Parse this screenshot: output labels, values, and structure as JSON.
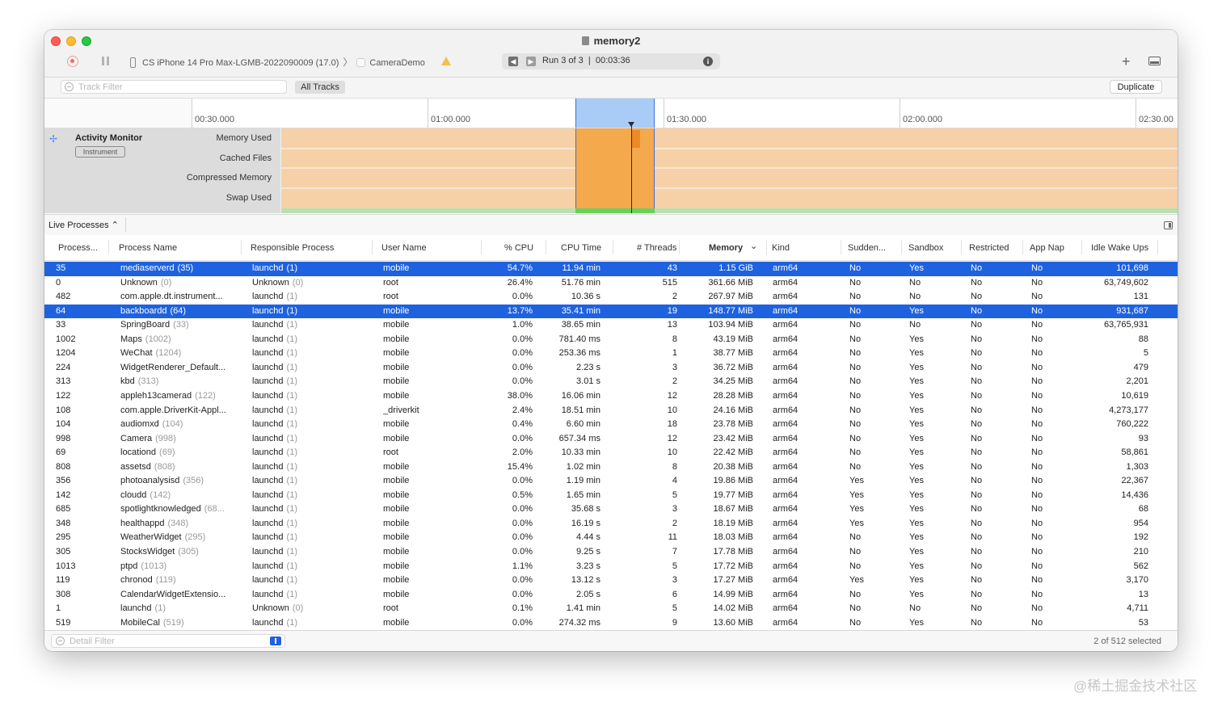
{
  "window": {
    "title": "memory2",
    "device": "CS iPhone 14 Pro Max-LGMB-2022090009 (17.0)",
    "path_separator": "〉",
    "target_app": "CameraDemo",
    "run_label": "Run 3 of 3",
    "run_separator": "|",
    "run_time": "00:03:36",
    "info_glyph": "i",
    "add_glyph": "+",
    "prev_glyph": "◀",
    "next_glyph": "▶"
  },
  "filterbar": {
    "track_filter_placeholder": "Track Filter",
    "all_tracks_label": "All Tracks",
    "duplicate_label": "Duplicate"
  },
  "timeline": {
    "ticks": [
      "00:30.000",
      "01:00.000",
      "01:30.000",
      "02:00.000",
      "02:30.00"
    ]
  },
  "instrument": {
    "icon_glyph": "✢",
    "name": "Activity Monitor",
    "badge": "Instrument",
    "lanes": [
      "Memory Used",
      "Cached Files",
      "Compressed Memory",
      "Swap Used"
    ]
  },
  "live_processes": {
    "label": "Live Processes ⌃"
  },
  "table": {
    "columns": [
      "Process...",
      "Process Name",
      "Responsible Process",
      "User Name",
      "% CPU",
      "CPU Time",
      "# Threads",
      "Memory",
      "Kind",
      "Sudden...",
      "Sandbox",
      "Restricted",
      "App Nap",
      "Idle Wake Ups"
    ],
    "sort_indicator": "⌄",
    "rows": [
      {
        "pid": "35",
        "name": "mediaserverd",
        "npid": "(35)",
        "resp": "launchd",
        "rpid": "(1)",
        "user": "mobile",
        "cpu": "54.7%",
        "time": "11.94 min",
        "threads": "43",
        "mem": "1.15 GiB",
        "kind": "arm64",
        "sudden": "No",
        "sandbox": "Yes",
        "restricted": "No",
        "nap": "No",
        "wake": "101,698",
        "selected": true
      },
      {
        "pid": "0",
        "name": "Unknown",
        "npid": "(0)",
        "resp": "Unknown",
        "rpid": "(0)",
        "user": "root",
        "cpu": "26.4%",
        "time": "51.76 min",
        "threads": "515",
        "mem": "361.66 MiB",
        "kind": "arm64",
        "sudden": "No",
        "sandbox": "No",
        "restricted": "No",
        "nap": "No",
        "wake": "63,749,602",
        "selected": false
      },
      {
        "pid": "482",
        "name": "com.apple.dt.instrument...",
        "npid": "",
        "resp": "launchd",
        "rpid": "(1)",
        "user": "root",
        "cpu": "0.0%",
        "time": "10.36 s",
        "threads": "2",
        "mem": "267.97 MiB",
        "kind": "arm64",
        "sudden": "No",
        "sandbox": "No",
        "restricted": "No",
        "nap": "No",
        "wake": "131",
        "selected": false
      },
      {
        "pid": "64",
        "name": "backboardd",
        "npid": "(64)",
        "resp": "launchd",
        "rpid": "(1)",
        "user": "mobile",
        "cpu": "13.7%",
        "time": "35.41 min",
        "threads": "19",
        "mem": "148.77 MiB",
        "kind": "arm64",
        "sudden": "No",
        "sandbox": "Yes",
        "restricted": "No",
        "nap": "No",
        "wake": "931,687",
        "selected": true
      },
      {
        "pid": "33",
        "name": "SpringBoard",
        "npid": "(33)",
        "resp": "launchd",
        "rpid": "(1)",
        "user": "mobile",
        "cpu": "1.0%",
        "time": "38.65 min",
        "threads": "13",
        "mem": "103.94 MiB",
        "kind": "arm64",
        "sudden": "No",
        "sandbox": "No",
        "restricted": "No",
        "nap": "No",
        "wake": "63,765,931",
        "selected": false
      },
      {
        "pid": "1002",
        "name": "Maps",
        "npid": "(1002)",
        "resp": "launchd",
        "rpid": "(1)",
        "user": "mobile",
        "cpu": "0.0%",
        "time": "781.40 ms",
        "threads": "8",
        "mem": "43.19 MiB",
        "kind": "arm64",
        "sudden": "No",
        "sandbox": "Yes",
        "restricted": "No",
        "nap": "No",
        "wake": "88",
        "selected": false
      },
      {
        "pid": "1204",
        "name": "WeChat",
        "npid": "(1204)",
        "resp": "launchd",
        "rpid": "(1)",
        "user": "mobile",
        "cpu": "0.0%",
        "time": "253.36 ms",
        "threads": "1",
        "mem": "38.77 MiB",
        "kind": "arm64",
        "sudden": "No",
        "sandbox": "Yes",
        "restricted": "No",
        "nap": "No",
        "wake": "5",
        "selected": false
      },
      {
        "pid": "224",
        "name": "WidgetRenderer_Default...",
        "npid": "",
        "resp": "launchd",
        "rpid": "(1)",
        "user": "mobile",
        "cpu": "0.0%",
        "time": "2.23 s",
        "threads": "3",
        "mem": "36.72 MiB",
        "kind": "arm64",
        "sudden": "No",
        "sandbox": "Yes",
        "restricted": "No",
        "nap": "No",
        "wake": "479",
        "selected": false
      },
      {
        "pid": "313",
        "name": "kbd",
        "npid": "(313)",
        "resp": "launchd",
        "rpid": "(1)",
        "user": "mobile",
        "cpu": "0.0%",
        "time": "3.01 s",
        "threads": "2",
        "mem": "34.25 MiB",
        "kind": "arm64",
        "sudden": "No",
        "sandbox": "Yes",
        "restricted": "No",
        "nap": "No",
        "wake": "2,201",
        "selected": false
      },
      {
        "pid": "122",
        "name": "appleh13camerad",
        "npid": "(122)",
        "resp": "launchd",
        "rpid": "(1)",
        "user": "mobile",
        "cpu": "38.0%",
        "time": "16.06 min",
        "threads": "12",
        "mem": "28.28 MiB",
        "kind": "arm64",
        "sudden": "No",
        "sandbox": "Yes",
        "restricted": "No",
        "nap": "No",
        "wake": "10,619",
        "selected": false
      },
      {
        "pid": "108",
        "name": "com.apple.DriverKit-Appl...",
        "npid": "",
        "resp": "launchd",
        "rpid": "(1)",
        "user": "_driverkit",
        "cpu": "2.4%",
        "time": "18.51 min",
        "threads": "10",
        "mem": "24.16 MiB",
        "kind": "arm64",
        "sudden": "No",
        "sandbox": "Yes",
        "restricted": "No",
        "nap": "No",
        "wake": "4,273,177",
        "selected": false
      },
      {
        "pid": "104",
        "name": "audiomxd",
        "npid": "(104)",
        "resp": "launchd",
        "rpid": "(1)",
        "user": "mobile",
        "cpu": "0.4%",
        "time": "6.60 min",
        "threads": "18",
        "mem": "23.78 MiB",
        "kind": "arm64",
        "sudden": "No",
        "sandbox": "Yes",
        "restricted": "No",
        "nap": "No",
        "wake": "760,222",
        "selected": false
      },
      {
        "pid": "998",
        "name": "Camera",
        "npid": "(998)",
        "resp": "launchd",
        "rpid": "(1)",
        "user": "mobile",
        "cpu": "0.0%",
        "time": "657.34 ms",
        "threads": "12",
        "mem": "23.42 MiB",
        "kind": "arm64",
        "sudden": "No",
        "sandbox": "Yes",
        "restricted": "No",
        "nap": "No",
        "wake": "93",
        "selected": false
      },
      {
        "pid": "69",
        "name": "locationd",
        "npid": "(69)",
        "resp": "launchd",
        "rpid": "(1)",
        "user": "root",
        "cpu": "2.0%",
        "time": "10.33 min",
        "threads": "10",
        "mem": "22.42 MiB",
        "kind": "arm64",
        "sudden": "No",
        "sandbox": "Yes",
        "restricted": "No",
        "nap": "No",
        "wake": "58,861",
        "selected": false
      },
      {
        "pid": "808",
        "name": "assetsd",
        "npid": "(808)",
        "resp": "launchd",
        "rpid": "(1)",
        "user": "mobile",
        "cpu": "15.4%",
        "time": "1.02 min",
        "threads": "8",
        "mem": "20.38 MiB",
        "kind": "arm64",
        "sudden": "No",
        "sandbox": "Yes",
        "restricted": "No",
        "nap": "No",
        "wake": "1,303",
        "selected": false
      },
      {
        "pid": "356",
        "name": "photoanalysisd",
        "npid": "(356)",
        "resp": "launchd",
        "rpid": "(1)",
        "user": "mobile",
        "cpu": "0.0%",
        "time": "1.19 min",
        "threads": "4",
        "mem": "19.86 MiB",
        "kind": "arm64",
        "sudden": "Yes",
        "sandbox": "Yes",
        "restricted": "No",
        "nap": "No",
        "wake": "22,367",
        "selected": false
      },
      {
        "pid": "142",
        "name": "cloudd",
        "npid": "(142)",
        "resp": "launchd",
        "rpid": "(1)",
        "user": "mobile",
        "cpu": "0.5%",
        "time": "1.65 min",
        "threads": "5",
        "mem": "19.77 MiB",
        "kind": "arm64",
        "sudden": "Yes",
        "sandbox": "Yes",
        "restricted": "No",
        "nap": "No",
        "wake": "14,436",
        "selected": false
      },
      {
        "pid": "685",
        "name": "spotlightknowledged",
        "npid": "(68...",
        "resp": "launchd",
        "rpid": "(1)",
        "user": "mobile",
        "cpu": "0.0%",
        "time": "35.68 s",
        "threads": "3",
        "mem": "18.67 MiB",
        "kind": "arm64",
        "sudden": "Yes",
        "sandbox": "Yes",
        "restricted": "No",
        "nap": "No",
        "wake": "68",
        "selected": false
      },
      {
        "pid": "348",
        "name": "healthappd",
        "npid": "(348)",
        "resp": "launchd",
        "rpid": "(1)",
        "user": "mobile",
        "cpu": "0.0%",
        "time": "16.19 s",
        "threads": "2",
        "mem": "18.19 MiB",
        "kind": "arm64",
        "sudden": "Yes",
        "sandbox": "Yes",
        "restricted": "No",
        "nap": "No",
        "wake": "954",
        "selected": false
      },
      {
        "pid": "295",
        "name": "WeatherWidget",
        "npid": "(295)",
        "resp": "launchd",
        "rpid": "(1)",
        "user": "mobile",
        "cpu": "0.0%",
        "time": "4.44 s",
        "threads": "11",
        "mem": "18.03 MiB",
        "kind": "arm64",
        "sudden": "No",
        "sandbox": "Yes",
        "restricted": "No",
        "nap": "No",
        "wake": "192",
        "selected": false
      },
      {
        "pid": "305",
        "name": "StocksWidget",
        "npid": "(305)",
        "resp": "launchd",
        "rpid": "(1)",
        "user": "mobile",
        "cpu": "0.0%",
        "time": "9.25 s",
        "threads": "7",
        "mem": "17.78 MiB",
        "kind": "arm64",
        "sudden": "No",
        "sandbox": "Yes",
        "restricted": "No",
        "nap": "No",
        "wake": "210",
        "selected": false
      },
      {
        "pid": "1013",
        "name": "ptpd",
        "npid": "(1013)",
        "resp": "launchd",
        "rpid": "(1)",
        "user": "mobile",
        "cpu": "1.1%",
        "time": "3.23 s",
        "threads": "5",
        "mem": "17.72 MiB",
        "kind": "arm64",
        "sudden": "No",
        "sandbox": "Yes",
        "restricted": "No",
        "nap": "No",
        "wake": "562",
        "selected": false
      },
      {
        "pid": "119",
        "name": "chronod",
        "npid": "(119)",
        "resp": "launchd",
        "rpid": "(1)",
        "user": "mobile",
        "cpu": "0.0%",
        "time": "13.12 s",
        "threads": "3",
        "mem": "17.27 MiB",
        "kind": "arm64",
        "sudden": "Yes",
        "sandbox": "Yes",
        "restricted": "No",
        "nap": "No",
        "wake": "3,170",
        "selected": false
      },
      {
        "pid": "308",
        "name": "CalendarWidgetExtensio...",
        "npid": "",
        "resp": "launchd",
        "rpid": "(1)",
        "user": "mobile",
        "cpu": "0.0%",
        "time": "2.05 s",
        "threads": "6",
        "mem": "14.99 MiB",
        "kind": "arm64",
        "sudden": "No",
        "sandbox": "Yes",
        "restricted": "No",
        "nap": "No",
        "wake": "13",
        "selected": false
      },
      {
        "pid": "1",
        "name": "launchd",
        "npid": "(1)",
        "resp": "Unknown",
        "rpid": "(0)",
        "user": "root",
        "cpu": "0.1%",
        "time": "1.41 min",
        "threads": "5",
        "mem": "14.02 MiB",
        "kind": "arm64",
        "sudden": "No",
        "sandbox": "No",
        "restricted": "No",
        "nap": "No",
        "wake": "4,711",
        "selected": false
      },
      {
        "pid": "519",
        "name": "MobileCal",
        "npid": "(519)",
        "resp": "launchd",
        "rpid": "(1)",
        "user": "mobile",
        "cpu": "0.0%",
        "time": "274.32 ms",
        "threads": "9",
        "mem": "13.60 MiB",
        "kind": "arm64",
        "sudden": "No",
        "sandbox": "Yes",
        "restricted": "No",
        "nap": "No",
        "wake": "53",
        "selected": false
      }
    ]
  },
  "bottombar": {
    "detail_filter_placeholder": "Detail Filter",
    "selection_status": "2 of 512 selected"
  },
  "watermark": "@稀土掘金技术社区"
}
